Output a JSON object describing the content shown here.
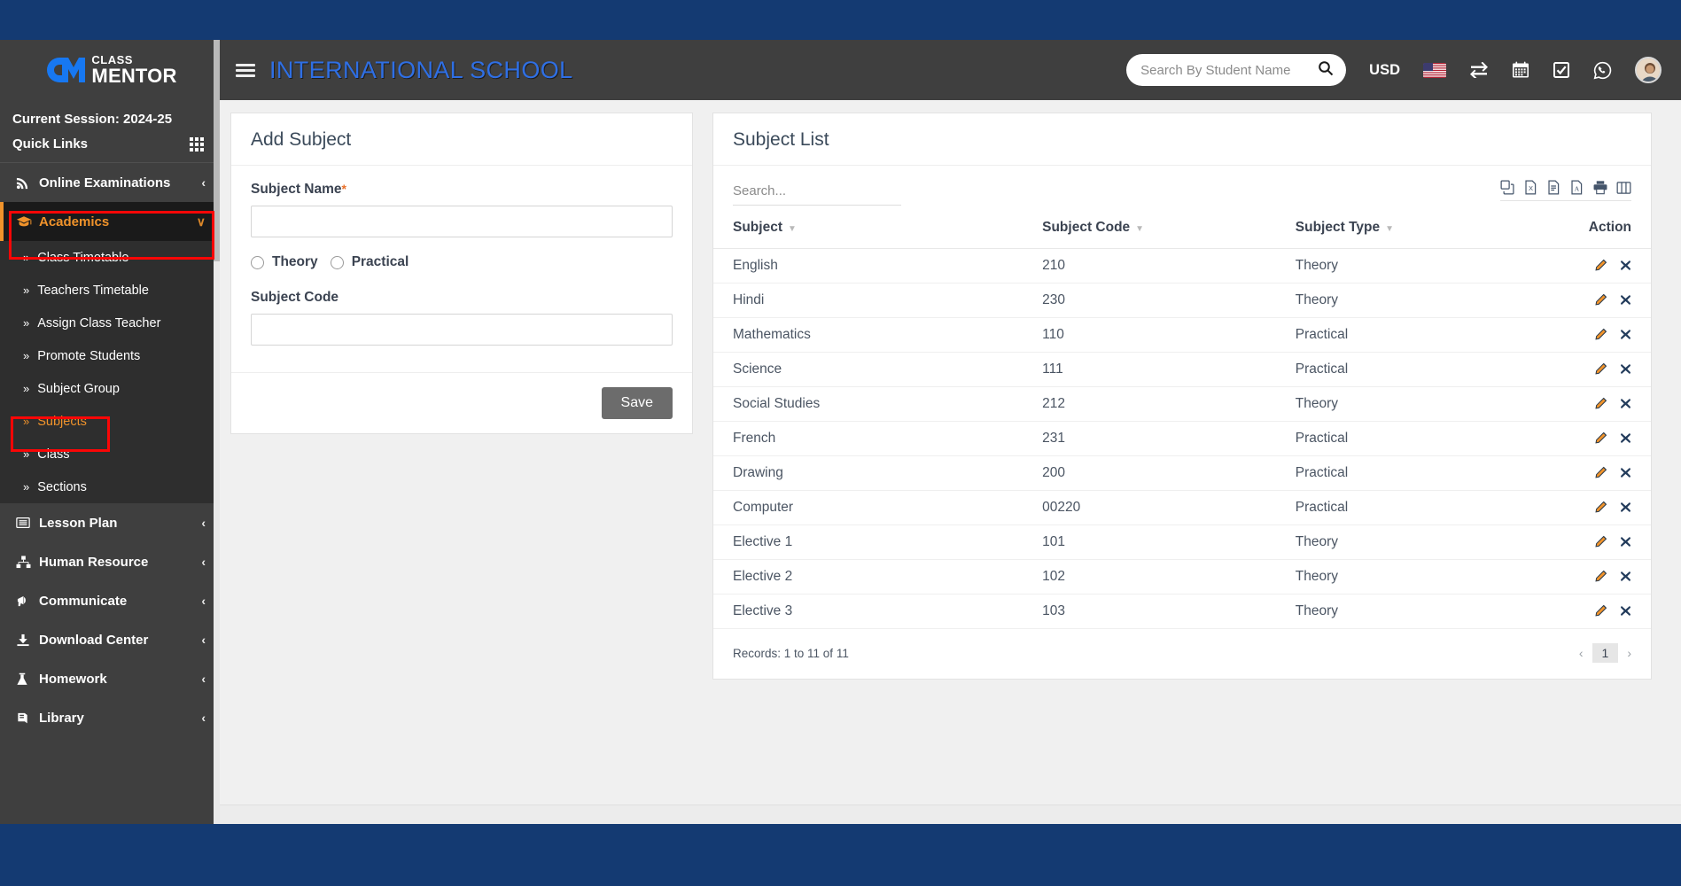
{
  "brand": {
    "line1": "CLASS",
    "line2": "MENTOR",
    "logo_icon": "cm-logo-icon"
  },
  "sidebar": {
    "session_label": "Current Session: 2024-25",
    "quick_links_label": "Quick Links",
    "quick_links_icon": "grid-icon",
    "items": [
      {
        "label": "Online Examinations",
        "icon": "rss-icon",
        "caret": "‹",
        "state": "collapsed"
      },
      {
        "label": "Academics",
        "icon": "graduation-cap-icon",
        "caret": "∨",
        "state": "expanded-active"
      },
      {
        "label": "Lesson Plan",
        "icon": "lesson-plan-icon",
        "caret": "‹",
        "state": "collapsed"
      },
      {
        "label": "Human Resource",
        "icon": "org-chart-icon",
        "caret": "‹",
        "state": "collapsed"
      },
      {
        "label": "Communicate",
        "icon": "megaphone-icon",
        "caret": "‹",
        "state": "collapsed"
      },
      {
        "label": "Download Center",
        "icon": "download-icon",
        "caret": "‹",
        "state": "collapsed"
      },
      {
        "label": "Homework",
        "icon": "flask-icon",
        "caret": "‹",
        "state": "collapsed"
      },
      {
        "label": "Library",
        "icon": "book-icon",
        "caret": "‹",
        "state": "collapsed"
      }
    ],
    "academics_submenu": [
      {
        "label": "Class Timetable",
        "selected": false
      },
      {
        "label": "Teachers Timetable",
        "selected": false
      },
      {
        "label": "Assign Class Teacher",
        "selected": false
      },
      {
        "label": "Promote Students",
        "selected": false
      },
      {
        "label": "Subject Group",
        "selected": false
      },
      {
        "label": "Subjects",
        "selected": true
      },
      {
        "label": "Class",
        "selected": false
      },
      {
        "label": "Sections",
        "selected": false
      }
    ],
    "submenu_bullet": "»"
  },
  "topbar": {
    "menu_toggle_icon": "hamburger-icon",
    "school_name": "INTERNATIONAL SCHOOL",
    "search_placeholder": "Search By Student Name",
    "search_value": "",
    "search_icon": "search-icon",
    "currency": "USD",
    "icons": [
      "us-flag-icon",
      "exchange-arrows-icon",
      "calendar-icon",
      "checkbox-icon",
      "whatsapp-icon",
      "avatar"
    ]
  },
  "form": {
    "title": "Add Subject",
    "subject_name_label": "Subject Name",
    "required_mark": "*",
    "subject_name_value": "",
    "radio_theory": "Theory",
    "radio_practical": "Practical",
    "subject_code_label": "Subject Code",
    "subject_code_value": "",
    "save_label": "Save"
  },
  "list": {
    "title": "Subject List",
    "search_placeholder": "Search...",
    "search_value": "",
    "export_icons": [
      "copy-icon",
      "excel-icon",
      "csv-icon",
      "pdf-icon",
      "print-icon",
      "column-visibility-icon"
    ],
    "columns": [
      "Subject",
      "Subject Code",
      "Subject Type",
      "Action"
    ],
    "rows": [
      {
        "subject": "English",
        "code": "210",
        "type": "Theory"
      },
      {
        "subject": "Hindi",
        "code": "230",
        "type": "Theory"
      },
      {
        "subject": "Mathematics",
        "code": "110",
        "type": "Practical"
      },
      {
        "subject": "Science",
        "code": "111",
        "type": "Practical"
      },
      {
        "subject": "Social Studies",
        "code": "212",
        "type": "Theory"
      },
      {
        "subject": "French",
        "code": "231",
        "type": "Practical"
      },
      {
        "subject": "Drawing",
        "code": "200",
        "type": "Practical"
      },
      {
        "subject": "Computer",
        "code": "00220",
        "type": "Practical"
      },
      {
        "subject": "Elective 1",
        "code": "101",
        "type": "Theory"
      },
      {
        "subject": "Elective 2",
        "code": "102",
        "type": "Theory"
      },
      {
        "subject": "Elective 3",
        "code": "103",
        "type": "Theory"
      }
    ],
    "row_actions": [
      "edit-pencil-icon",
      "delete-x-icon"
    ],
    "records_text": "Records: 1 to 11 of 11",
    "pager": {
      "prev": "‹",
      "page": "1",
      "next": "›"
    }
  },
  "colors": {
    "band": "#143a72",
    "sidebar": "#3f3f3f",
    "submenu": "#2e2e2e",
    "active_bg": "#1a1a1a",
    "accent_orange": "#f0932b",
    "title_blue": "#2f6fe4",
    "annotation_red": "#fb0606"
  }
}
